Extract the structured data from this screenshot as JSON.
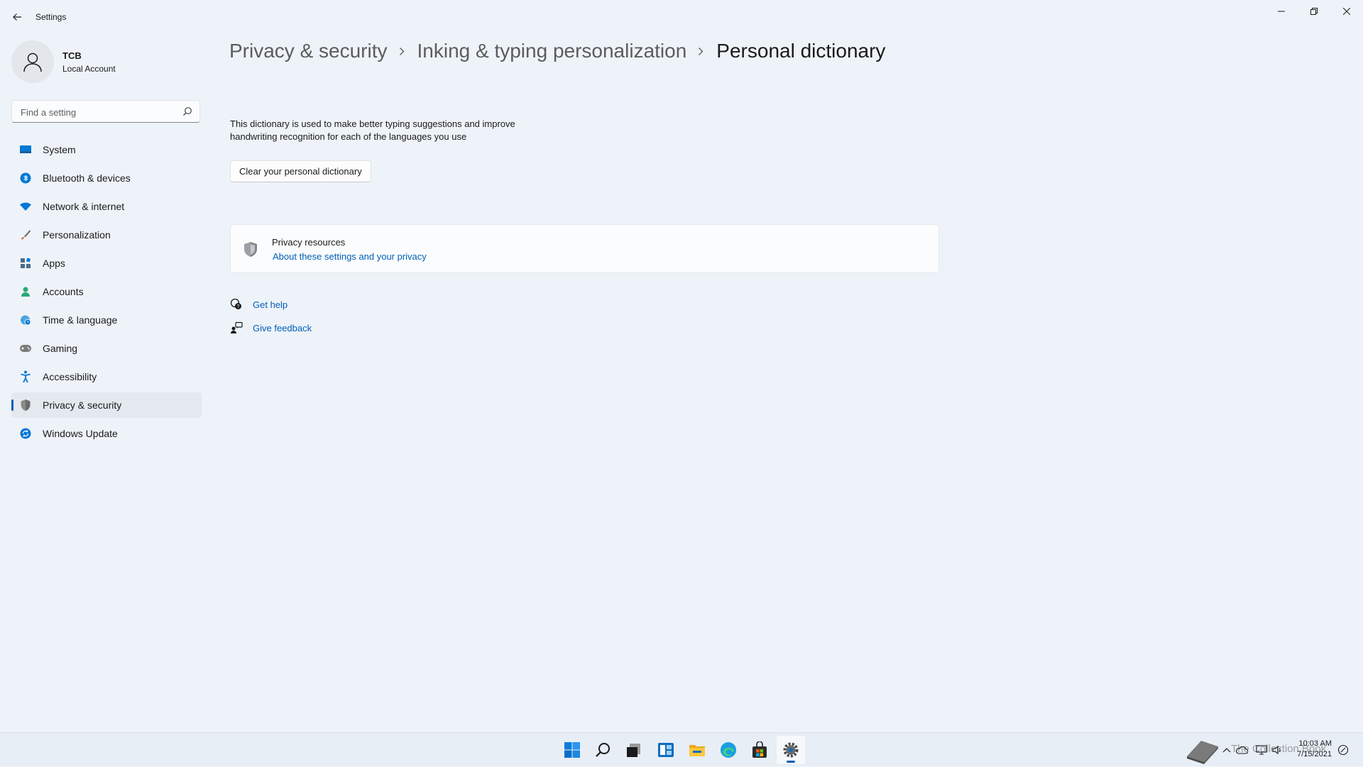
{
  "window": {
    "title": "Settings",
    "controls": [
      "minimize",
      "restore",
      "close"
    ]
  },
  "profile": {
    "name": "TCB",
    "account_type": "Local Account"
  },
  "search": {
    "placeholder": "Find a setting",
    "value": ""
  },
  "sidebar": {
    "items": [
      {
        "label": "System",
        "icon": "system-icon",
        "color": "#0078d4"
      },
      {
        "label": "Bluetooth & devices",
        "icon": "bluetooth-icon",
        "color": "#0078d4"
      },
      {
        "label": "Network & internet",
        "icon": "wifi-icon",
        "color": "#0078d4"
      },
      {
        "label": "Personalization",
        "icon": "brush-icon",
        "color": "#e8743b"
      },
      {
        "label": "Apps",
        "icon": "apps-icon",
        "color": "#4a6b8a"
      },
      {
        "label": "Accounts",
        "icon": "person-icon",
        "color": "#2aa876"
      },
      {
        "label": "Time & language",
        "icon": "globe-clock-icon",
        "color": "#0078d4"
      },
      {
        "label": "Gaming",
        "icon": "gamepad-icon",
        "color": "#6b6b6b"
      },
      {
        "label": "Accessibility",
        "icon": "accessibility-icon",
        "color": "#0078d4"
      },
      {
        "label": "Privacy & security",
        "icon": "shield-icon",
        "color": "#6b6b6b",
        "active": true
      },
      {
        "label": "Windows Update",
        "icon": "update-icon",
        "color": "#0078d4"
      }
    ]
  },
  "breadcrumb": {
    "level1": "Privacy & security",
    "level2": "Inking & typing personalization",
    "current": "Personal dictionary"
  },
  "content": {
    "description": "This dictionary is used to make better typing suggestions and improve handwriting recognition for each of the languages you use",
    "clear_button": "Clear your personal dictionary",
    "privacy_card": {
      "title": "Privacy resources",
      "link": "About these settings and your privacy"
    },
    "help": {
      "get_help": "Get help",
      "give_feedback": "Give feedback"
    }
  },
  "taskbar": {
    "apps": [
      "start-icon",
      "search-icon",
      "task-view-icon",
      "widgets-icon",
      "file-explorer-icon",
      "edge-icon",
      "store-icon",
      "settings-icon"
    ],
    "active_app": "settings-icon",
    "clock_time": "10:03 AM",
    "clock_date": "7/15/2021",
    "watermark": "The Collection Book"
  },
  "colors": {
    "accent": "#005fb8",
    "background": "#eef3f9"
  }
}
